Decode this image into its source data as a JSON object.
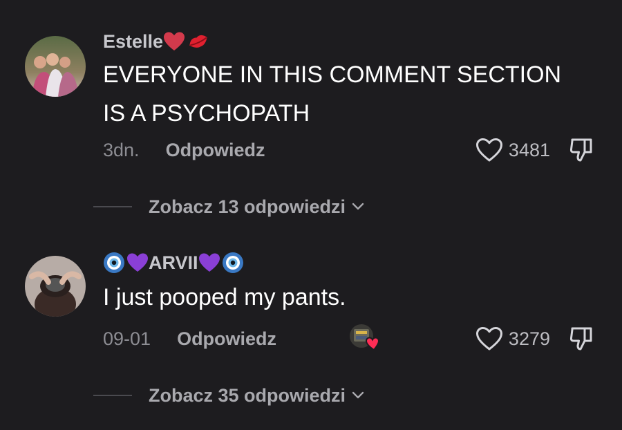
{
  "comments": [
    {
      "username": "Estelle",
      "text": "EVERYONE IN THIS COMMENT SECTION\nIS A PSYCHOPATH",
      "time": "3dn.",
      "reply_label": "Odpowiedz",
      "likes": "3481",
      "view_replies": "Zobacz 13 odpowiedzi"
    },
    {
      "username": "ARVII",
      "text": "I just pooped my pants.",
      "time": "09-01",
      "reply_label": "Odpowiedz",
      "likes": "3279",
      "view_replies": "Zobacz 35 odpowiedzi"
    }
  ],
  "icons": {
    "like": "heart-outline-icon",
    "dislike": "thumbs-down-icon",
    "expand": "chevron-down-icon"
  }
}
